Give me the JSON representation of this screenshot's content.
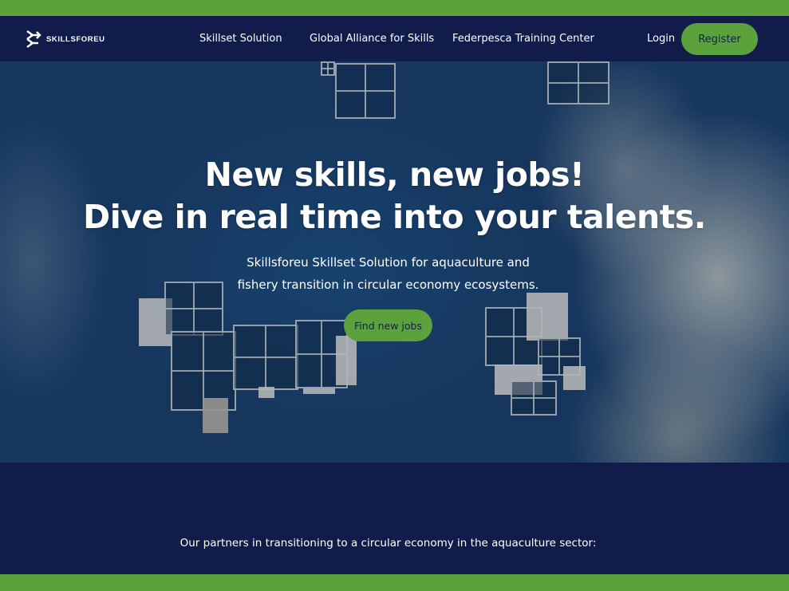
{
  "brand": {
    "logo_text": "SKILLSFOREU"
  },
  "nav": {
    "links": [
      {
        "label": "Skillset Solution"
      },
      {
        "label": "Global Alliance for Skills"
      },
      {
        "label": "Federpesca Training Center"
      }
    ],
    "login_label": "Login",
    "register_label": "Register"
  },
  "hero": {
    "title_line1": "New skills, new jobs!",
    "title_line2": "Dive in real time into your talents.",
    "subtitle_line1": "Skillsforeu Skillset Solution for aquaculture and",
    "subtitle_line2": "fishery transition in circular economy ecosystems.",
    "cta_label": "Find new jobs"
  },
  "partners": {
    "heading": "Our partners in transitioning to a circular economy in the aquaculture sector:"
  },
  "colors": {
    "navy": "#121c4a",
    "green": "#5ca23c",
    "white": "#ffffff"
  }
}
